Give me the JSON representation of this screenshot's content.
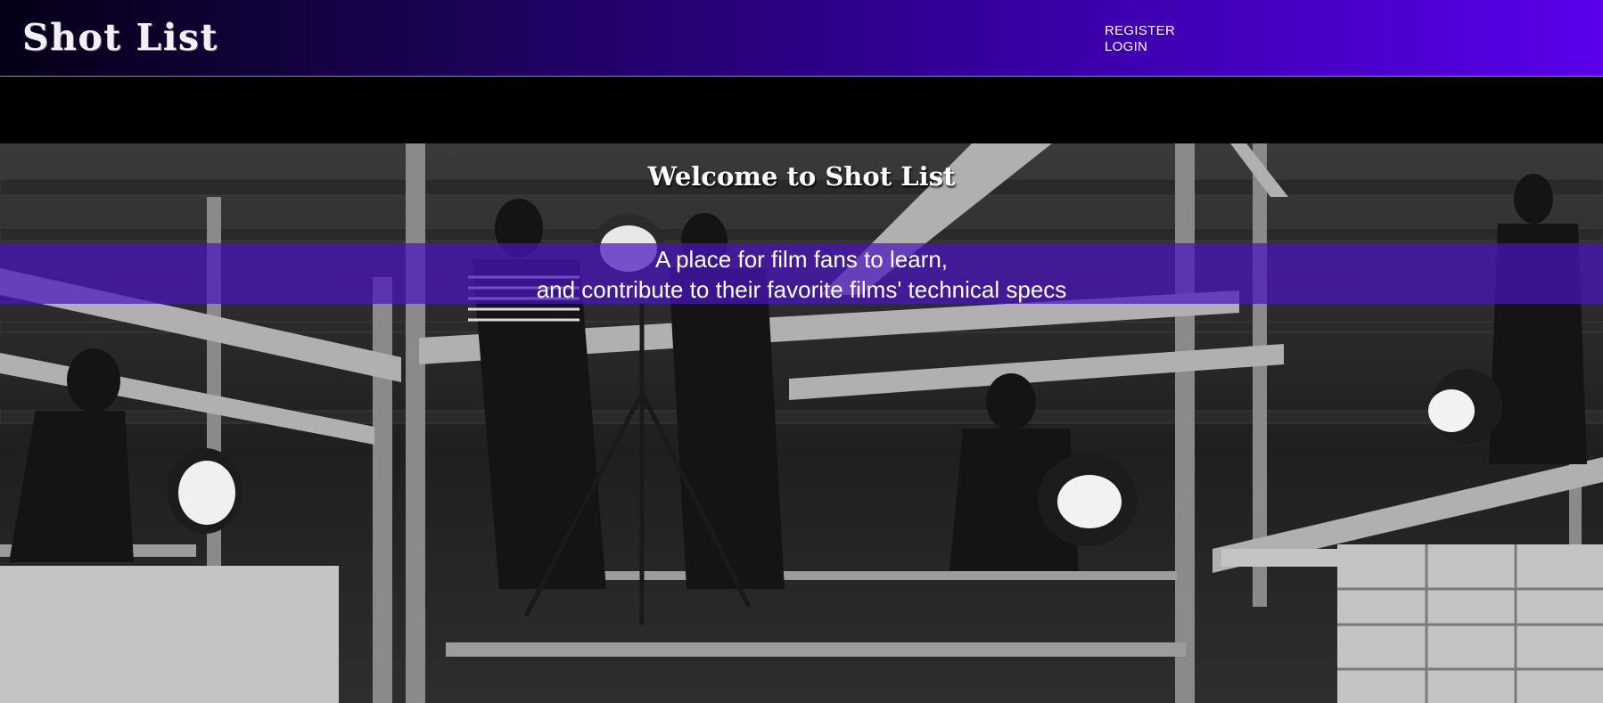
{
  "header": {
    "logo": "Shot List",
    "nav": [
      {
        "label": "REGISTER"
      },
      {
        "label": "LOGIN"
      }
    ]
  },
  "hero": {
    "title": "Welcome to Shot List",
    "tagline_line1": "A place for film fans to learn,",
    "tagline_line2": "and contribute to their favorite films' technical specs"
  },
  "colors": {
    "header_gradient_start": "#050016",
    "header_gradient_end": "#5a00ea",
    "band": "#4a14be"
  }
}
